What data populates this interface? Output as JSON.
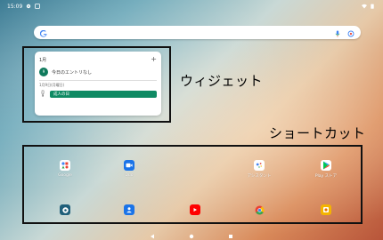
{
  "status_bar": {
    "time": "15:09",
    "icons": [
      "gear-icon",
      "settings-icon"
    ],
    "right_icons": [
      "wifi-icon",
      "battery-icon"
    ]
  },
  "search": {
    "logo": "G",
    "icons": [
      "mic-icon",
      "lens-icon"
    ]
  },
  "widget": {
    "month": "1月",
    "add": "+",
    "today_day": "9",
    "today_text": "今日のエントリなし",
    "holiday_date": "1月9日(月曜日)",
    "holiday_day_label": "月",
    "holiday_day_number": "9",
    "holiday_name": "成人の日"
  },
  "labels": {
    "widget_label": "ウィジェット",
    "shortcut_label": "ショートカット"
  },
  "apps_row1": [
    {
      "name": "Google",
      "icon": "google-folder-icon"
    },
    {
      "name": "Duo",
      "icon": "duo-icon"
    },
    {
      "name": "アシスタント",
      "icon": "assistant-icon"
    },
    {
      "name": "Play ストア",
      "icon": "play-store-icon"
    }
  ],
  "apps_row2": [
    {
      "name": "",
      "icon": "settings-icon"
    },
    {
      "name": "",
      "icon": "contacts-icon"
    },
    {
      "name": "",
      "icon": "youtube-icon"
    },
    {
      "name": "",
      "icon": "chrome-icon"
    },
    {
      "name": "",
      "icon": "photos-icon"
    }
  ],
  "nav": [
    "back-icon",
    "home-icon",
    "recents-icon"
  ],
  "colors": {
    "calendar_green": "#0f8a63",
    "frame": "#111111"
  }
}
